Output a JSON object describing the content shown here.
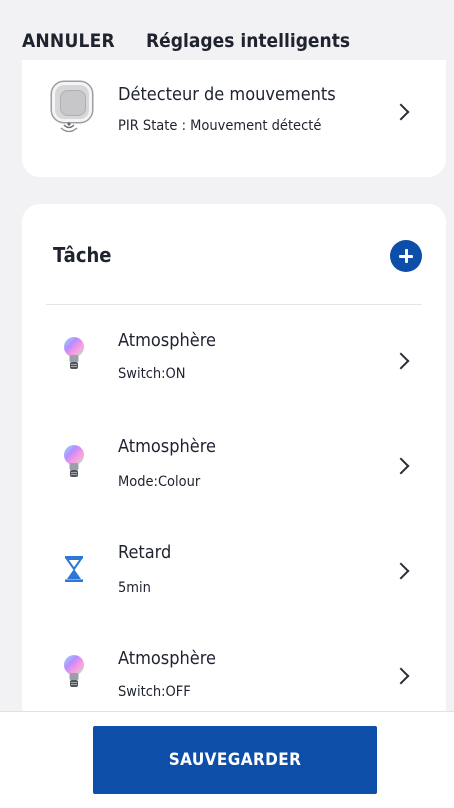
{
  "header": {
    "cancel_label": "ANNULER",
    "title": "Réglages intelligents"
  },
  "condition": {
    "device_name": "Détecteur de mouvements",
    "state": "PIR State : Mouvement détecté",
    "icon": "motion-sensor-icon"
  },
  "tasks": {
    "section_title": "Tâche",
    "add_icon": "plus-circle-icon",
    "items": [
      {
        "name": "Atmosphère",
        "detail": "Switch:ON",
        "icon": "bulb-icon"
      },
      {
        "name": "Atmosphère",
        "detail": "Mode:Colour",
        "icon": "bulb-icon"
      },
      {
        "name": "Retard",
        "detail": "5min",
        "icon": "hourglass-icon"
      },
      {
        "name": "Atmosphère",
        "detail": "Switch:OFF",
        "icon": "bulb-icon"
      }
    ]
  },
  "footer": {
    "save_label": "SAUVEGARDER"
  },
  "colors": {
    "accent": "#0c4ea8",
    "background": "#f2f2f4",
    "card": "#ffffff"
  }
}
